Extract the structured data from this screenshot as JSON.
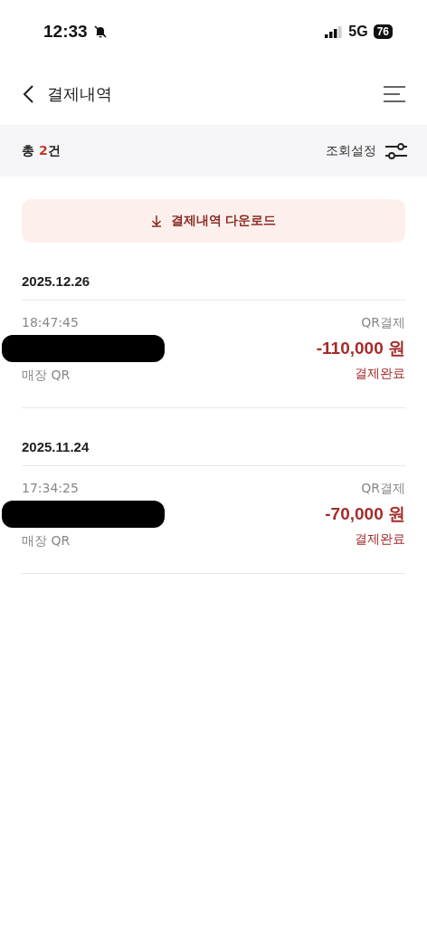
{
  "status_bar": {
    "time": "12:33",
    "network": "5G",
    "battery": "76"
  },
  "header": {
    "title": "결제내역"
  },
  "summary": {
    "prefix": "총 ",
    "count": "2",
    "suffix": "건",
    "filter_label": "조회설정"
  },
  "download_button": {
    "label": "결제내역 다운로드"
  },
  "groups": [
    {
      "date": "2025.12.26",
      "transactions": [
        {
          "time": "18:47:45",
          "method": "QR결제",
          "redacted": true,
          "amount": "-110,000 원",
          "channel": "매장 QR",
          "status": "결제완료"
        }
      ]
    },
    {
      "date": "2025.11.24",
      "transactions": [
        {
          "time": "17:34:25",
          "method": "QR결제",
          "redacted": true,
          "amount": "-70,000 원",
          "channel": "매장 QR",
          "status": "결제완료"
        }
      ]
    }
  ]
}
